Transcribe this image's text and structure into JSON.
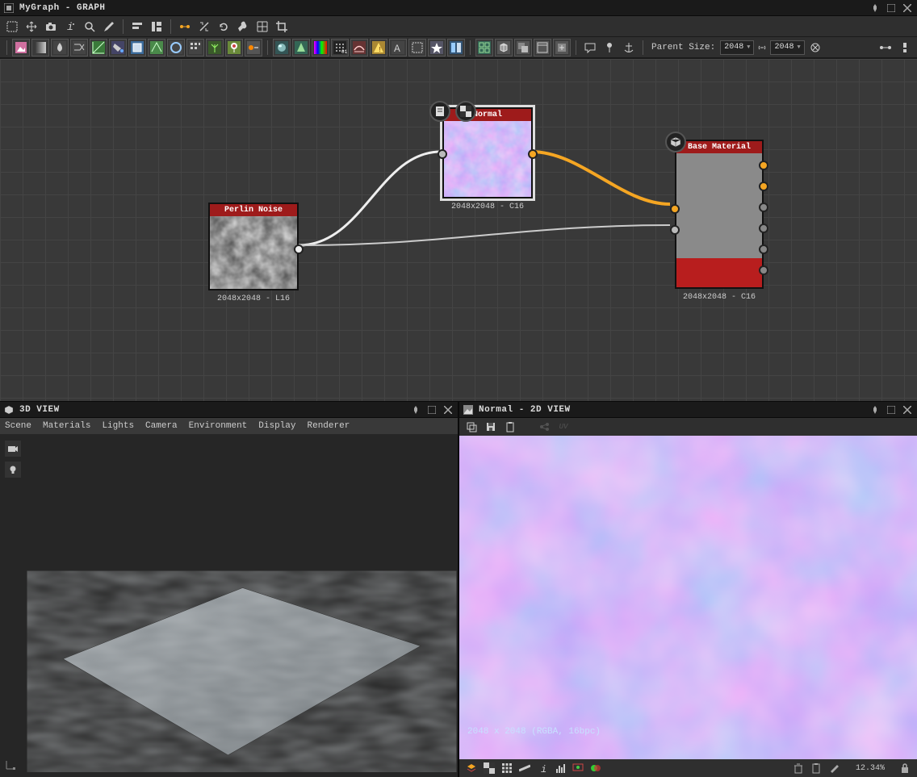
{
  "window": {
    "title": "MyGraph - GRAPH"
  },
  "parentSize": {
    "label": "Parent Size:",
    "valueA": "2048",
    "valueB": "2048"
  },
  "nodes": {
    "perlin": {
      "title": "Perlin Noise",
      "meta": "2048x2048 - L16"
    },
    "normal": {
      "title": "Normal",
      "meta": "2048x2048 - C16"
    },
    "baseMat": {
      "title": "Base Material",
      "meta": "2048x2048 - C16"
    }
  },
  "view3d": {
    "title": "3D VIEW",
    "menu": [
      "Scene",
      "Materials",
      "Lights",
      "Camera",
      "Environment",
      "Display",
      "Renderer"
    ]
  },
  "view2d": {
    "title": "Normal - 2D VIEW",
    "info": "2048 x 2048 (RGBA, 16bpc)",
    "zoom": "12.34%"
  }
}
